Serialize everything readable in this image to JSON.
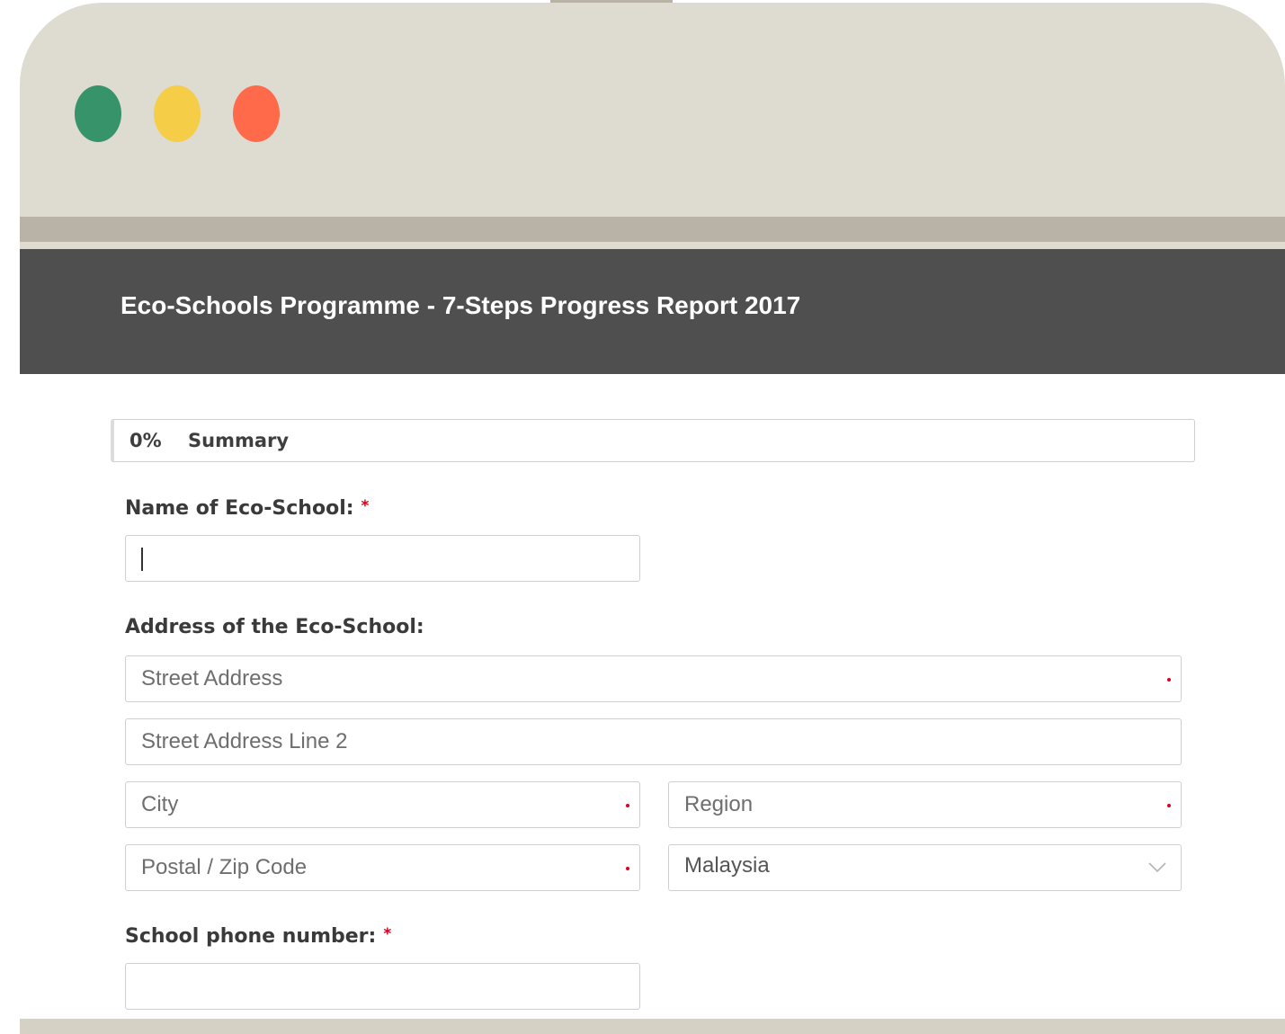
{
  "window": {
    "colors": {
      "chrome": "#dedbd0",
      "chrome_band": "#b9b2a6",
      "header_bg": "#4f4f4f",
      "dot_green": "#36936a",
      "dot_yellow": "#f6cd46",
      "dot_red": "#ff6b4a",
      "required": "#d0021b"
    }
  },
  "form": {
    "title": "Eco-Schools Programme - 7-Steps Progress Report 2017",
    "progress": {
      "percent_label": "0%",
      "section": "Summary"
    },
    "school_name": {
      "label": "Name of Eco-School:",
      "required_mark": "*",
      "value": ""
    },
    "address": {
      "label": "Address of the Eco-School:",
      "street": {
        "placeholder": "Street Address"
      },
      "street2": {
        "placeholder": "Street Address Line 2"
      },
      "city": {
        "placeholder": "City"
      },
      "region": {
        "placeholder": "Region"
      },
      "postal": {
        "placeholder": "Postal / Zip Code"
      },
      "country": {
        "selected": "Malaysia",
        "icon": "chevron-down-icon"
      }
    },
    "phone": {
      "label": "School phone number:",
      "required_mark": "*",
      "value": ""
    }
  }
}
